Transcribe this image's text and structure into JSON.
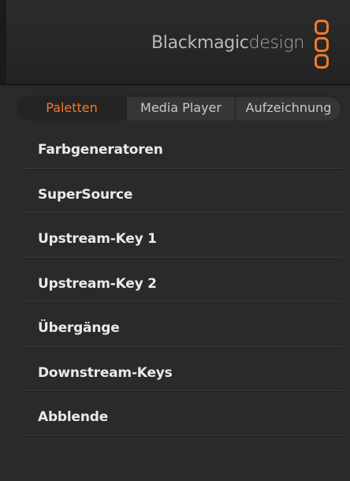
{
  "header": {
    "brand_main": "Blackmagic",
    "brand_light": "design",
    "logo_icon": "blackmagic-logo-icon",
    "accent_color": "#f07b2a"
  },
  "tabs": [
    {
      "label": "Paletten",
      "active": true
    },
    {
      "label": "Media Player",
      "active": false
    },
    {
      "label": "Aufzeichnung",
      "active": false
    }
  ],
  "palettes": [
    {
      "label": "Farbgeneratoren"
    },
    {
      "label": "SuperSource"
    },
    {
      "label": "Upstream-Key 1"
    },
    {
      "label": "Upstream-Key 2"
    },
    {
      "label": "Übergänge"
    },
    {
      "label": "Downstream-Keys"
    },
    {
      "label": "Abblende"
    }
  ]
}
